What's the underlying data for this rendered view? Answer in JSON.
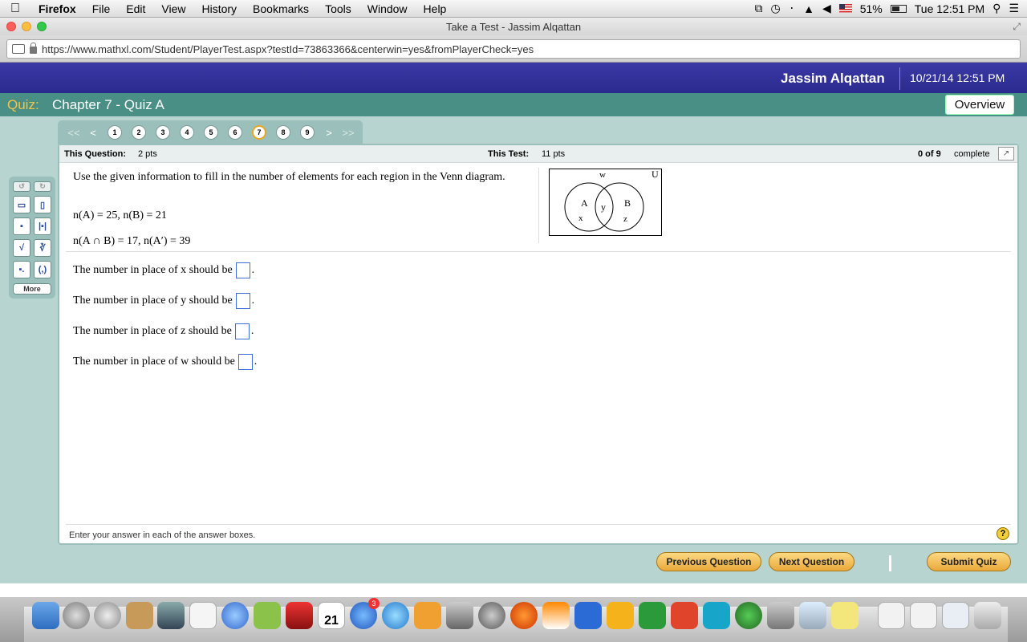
{
  "menubar": {
    "app": "Firefox",
    "items": [
      "File",
      "Edit",
      "View",
      "History",
      "Bookmarks",
      "Tools",
      "Window",
      "Help"
    ],
    "battery": "51%",
    "clock": "Tue 12:51 PM"
  },
  "window": {
    "title": "Take a Test - Jassim Alqattan"
  },
  "browser": {
    "url": "https://www.mathxl.com/Student/PlayerTest.aspx?testId=73863366&centerwin=yes&fromPlayerCheck=yes"
  },
  "header": {
    "user_name": "Jassim Alqattan",
    "datetime": "10/21/14 12:51 PM"
  },
  "quiz": {
    "label": "Quiz:",
    "title": "Chapter 7 - Quiz A",
    "overview_label": "Overview"
  },
  "question_nav": {
    "first": "<<",
    "prev": "<",
    "next": ">",
    "last": ">>",
    "numbers": [
      "1",
      "2",
      "3",
      "4",
      "5",
      "6",
      "7",
      "8",
      "9"
    ],
    "current": "7"
  },
  "info": {
    "this_question_label": "This Question:",
    "this_question_value": "2 pts",
    "this_test_label": "This Test:",
    "this_test_value": "11 pts",
    "progress": "0 of 9",
    "progress_suffix": "complete"
  },
  "question": {
    "prompt": "Use the given information to fill in the number of elements for each region in the Venn diagram.",
    "given1": "n(A) = 25, n(B) = 21",
    "given2": "n(A ∩ B) = 17, n(A′) = 39",
    "venn": {
      "u": "U",
      "w": "w",
      "a": "A",
      "b": "B",
      "x": "x",
      "y": "y",
      "z": "z"
    },
    "lines": [
      {
        "text": "The number in place of x should be",
        "value": ""
      },
      {
        "text": "The number in place of y should be",
        "value": ""
      },
      {
        "text": "The number in place of z should be",
        "value": ""
      },
      {
        "text": "The number in place of w should be",
        "value": ""
      }
    ]
  },
  "footer": {
    "instructions": "Enter your answer in each of the answer boxes.",
    "help": "?"
  },
  "actions": {
    "previous": "Previous Question",
    "next": "Next Question",
    "submit": "Submit Quiz"
  },
  "toolbox": {
    "more": "More"
  },
  "dock": {
    "calendar_day": "21",
    "badge": "3"
  }
}
